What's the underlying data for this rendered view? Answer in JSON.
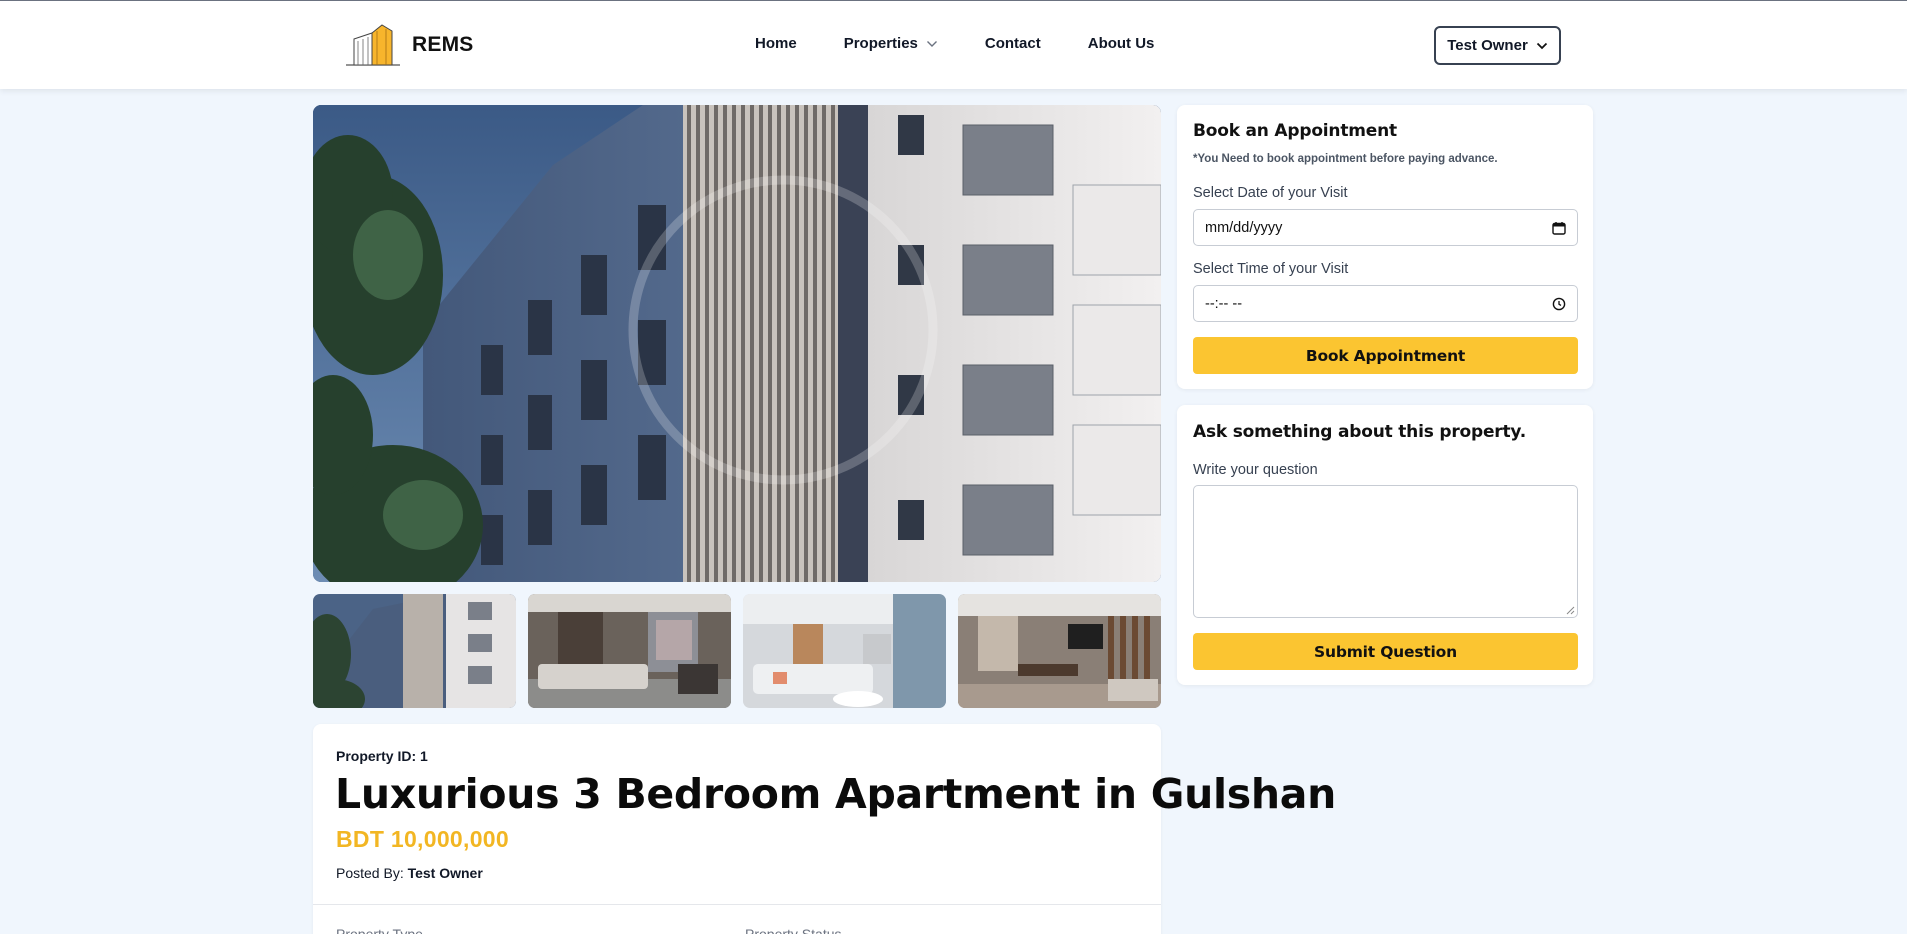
{
  "brand": {
    "name": "REMS",
    "accent": "#fbc531"
  },
  "nav": {
    "home": "Home",
    "properties": "Properties",
    "contact": "Contact",
    "about": "About Us"
  },
  "user": {
    "name": "Test Owner"
  },
  "gallery": {
    "main": "building-exterior",
    "thumbnails": [
      "building-exterior",
      "living-room-gray-sofa",
      "living-room-white",
      "living-dining-wood"
    ]
  },
  "property": {
    "id_label": "Property ID: 1",
    "title": "Luxurious 3 Bedroom Apartment in Gulshan",
    "price": "BDT 10,000,000",
    "posted_by_label": "Posted By:",
    "posted_by_name": "Test Owner",
    "type_label": "Property Type",
    "status_label": "Property Status"
  },
  "appointment": {
    "title": "Book an Appointment",
    "note": "*You Need to book appointment before paying advance.",
    "date_label": "Select Date of your Visit",
    "date_placeholder": "mm/dd/yyyy",
    "time_label": "Select Time of your Visit",
    "time_placeholder": "--:-- --",
    "button": "Book Appointment"
  },
  "question": {
    "title": "Ask something about this property.",
    "label": "Write your question",
    "value": "",
    "button": "Submit Question"
  },
  "colors": {
    "page_bg": "#f0f6fd",
    "price": "#f2b623",
    "button": "#fbc531"
  }
}
